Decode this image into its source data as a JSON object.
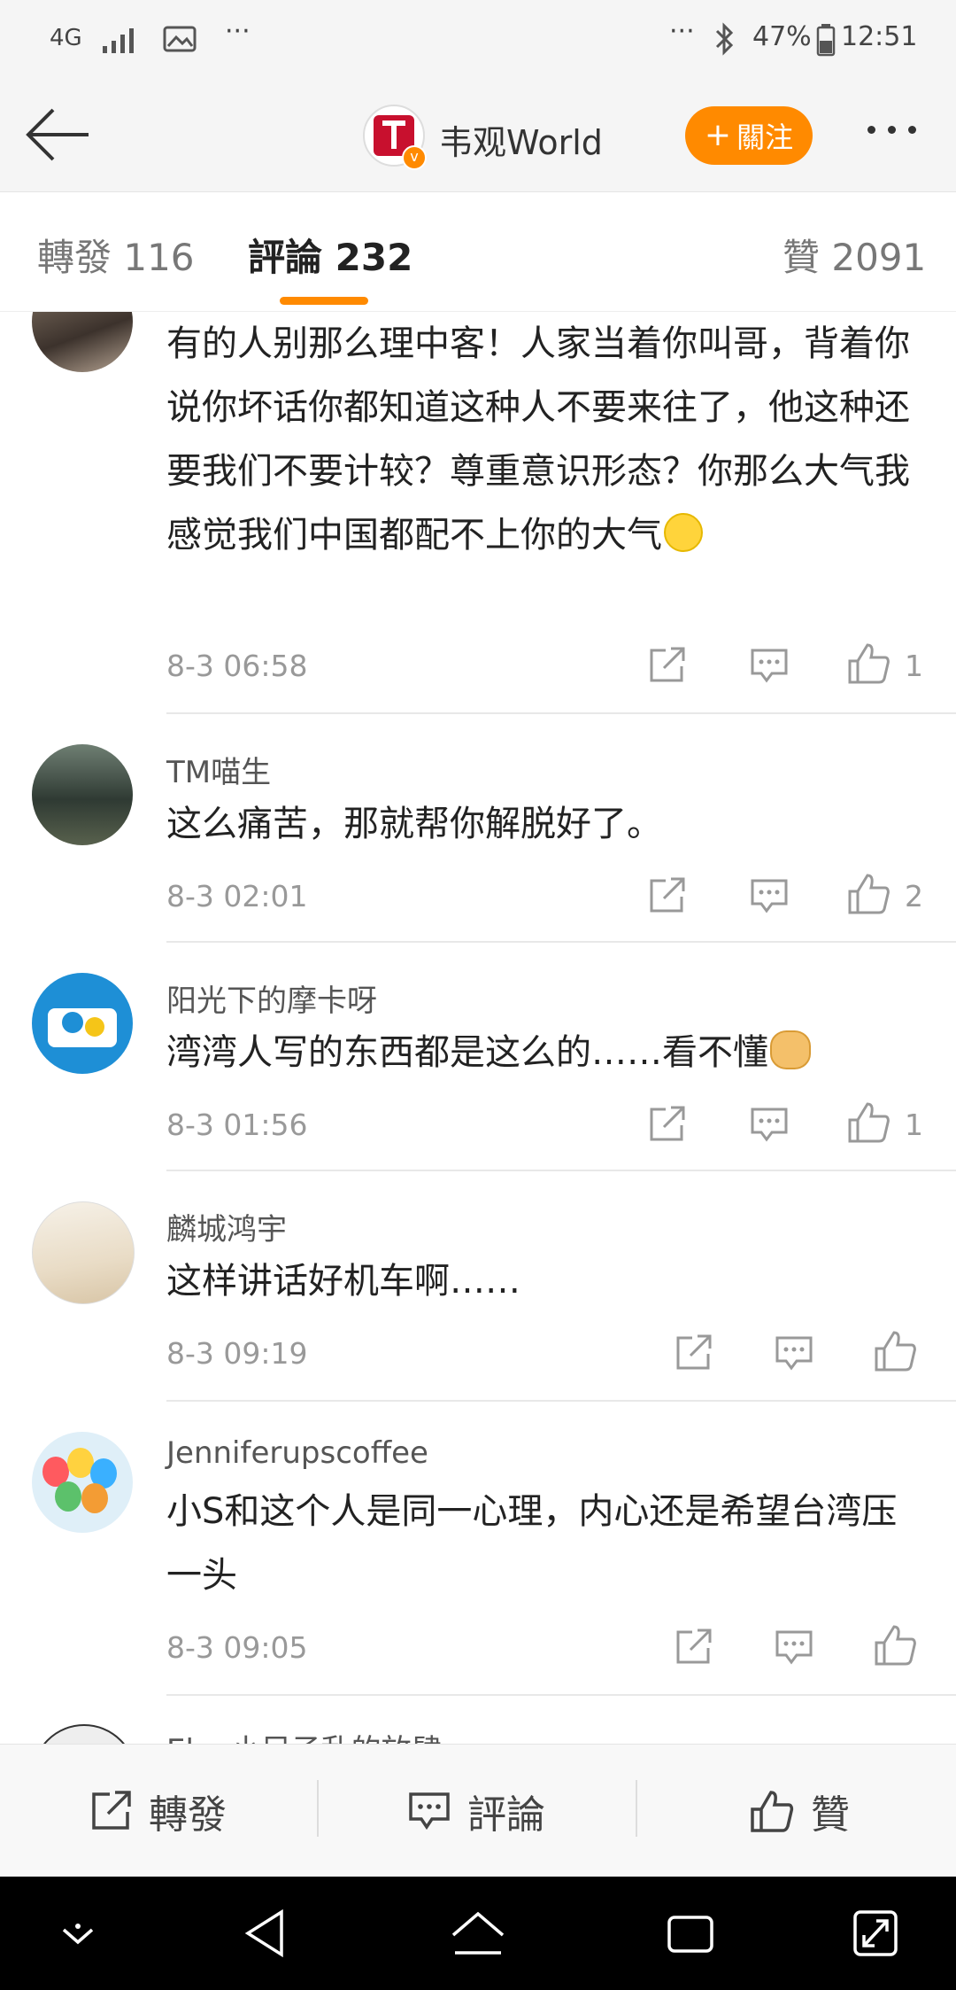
{
  "status_bar": {
    "network": "4G",
    "overflow": "···",
    "right_overflow": "···",
    "battery": "47%",
    "time": "12:51"
  },
  "header": {
    "title": "韦观World",
    "follow_label": "關注",
    "verified_badge": "v",
    "accent": "#ff8a00"
  },
  "tabs": [
    {
      "label": "轉發 116"
    },
    {
      "label": "評論 232"
    },
    {
      "label": "贊 2091"
    }
  ],
  "comments": [
    {
      "username": "",
      "text": "有的人别那么理中客！人家当着你叫哥，背着你说你坏话你都知道这种人不要来往了，他这种还要我们不要计较？尊重意识形态？你那么大气我感觉我们中国都配不上你的大气",
      "emoji": "smile-emoji",
      "time": "8-3 06:58",
      "likes": "1"
    },
    {
      "username": "TM喵生",
      "text": "这么痛苦，那就帮你解脱好了。",
      "time": "8-3 02:01",
      "likes": "2"
    },
    {
      "username": "阳光下的摩卡呀",
      "text": "湾湾人写的东西都是这么的……看不懂",
      "emoji": "doge-emoji",
      "time": "8-3 01:56",
      "likes": "1"
    },
    {
      "username": "麟城鸿宇",
      "text": "这样讲话好机车啊……",
      "time": "8-3 09:19",
      "likes": ""
    },
    {
      "username": "Jenniferupscoffee",
      "text": "小S和这个人是同一心理，内心还是希望台湾压一头",
      "time": "8-3 09:05",
      "likes": ""
    },
    {
      "username": "Eleo小兄子乱的放肆",
      "text": "",
      "time": "",
      "likes": ""
    }
  ],
  "bottom_bar": {
    "repost": "轉發",
    "comment": "評論",
    "like": "贊"
  }
}
